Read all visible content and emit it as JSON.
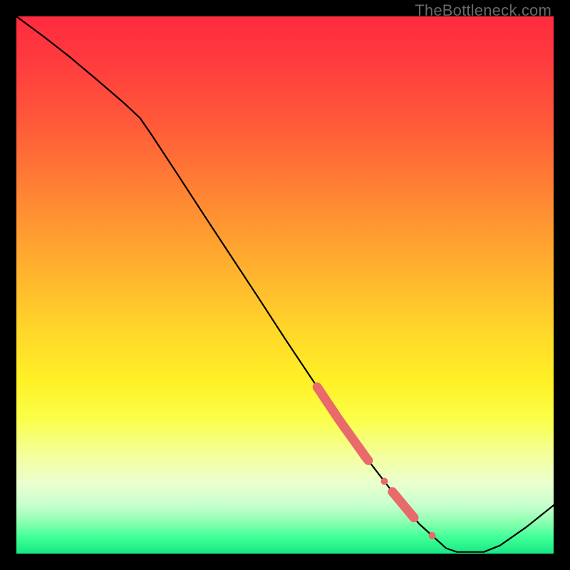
{
  "watermark": "TheBottleneck.com",
  "colors": {
    "gradient_top": "#ff2b3f",
    "gradient_bottom": "#17e884",
    "curve": "#000000",
    "marker": "#e86a6a",
    "frame_bg": "#000000",
    "watermark_text": "#696969"
  },
  "chart_data": {
    "type": "line",
    "title": "",
    "xlabel": "",
    "ylabel": "",
    "xlim": [
      0,
      100
    ],
    "ylim": [
      0,
      100
    ],
    "grid": false,
    "x": [
      0.0,
      5.0,
      10.0,
      15.0,
      20.0,
      23.0,
      25.0,
      30.0,
      35.0,
      40.0,
      45.0,
      50.0,
      55.0,
      60.0,
      65.0,
      70.0,
      75.0,
      80.0,
      82.0,
      87.0,
      90.0,
      95.0,
      100.0
    ],
    "values": [
      100.0,
      96.3,
      92.4,
      88.2,
      83.9,
      81.1,
      78.2,
      70.6,
      62.9,
      55.3,
      47.7,
      40.0,
      32.5,
      25.0,
      18.0,
      11.5,
      5.5,
      1.0,
      0.3,
      0.3,
      1.5,
      5.0,
      9.0
    ],
    "markers": [
      {
        "x_start": 56.0,
        "x_end": 65.5,
        "thick": true
      },
      {
        "x_start": 68.0,
        "x_end": 69.0,
        "thick": false
      },
      {
        "x_start": 70.0,
        "x_end": 74.0,
        "thick": true
      },
      {
        "x_start": 77.0,
        "x_end": 77.8,
        "thick": false
      }
    ]
  }
}
